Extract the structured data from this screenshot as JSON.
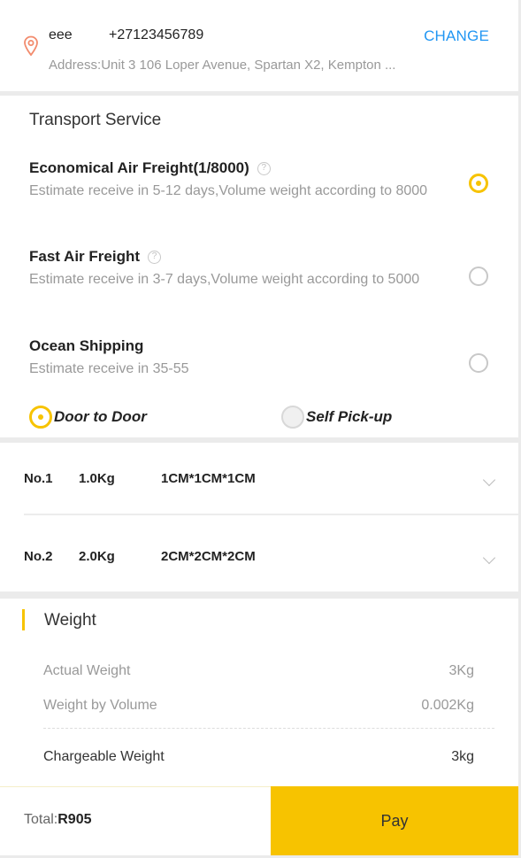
{
  "address": {
    "name": "eee",
    "phone": "+27123456789",
    "change_label": "CHANGE",
    "line": "Address:Unit 3 106 Loper Avenue, Spartan X2, Kempton ..."
  },
  "transport": {
    "title": "Transport Service",
    "options": [
      {
        "title": "Economical Air Freight(1/8000)",
        "has_help": true,
        "desc": "Estimate receive in 5-12 days,Volume weight according to 8000",
        "selected": true
      },
      {
        "title": "Fast Air Freight",
        "has_help": true,
        "desc": "Estimate receive in 3-7 days,Volume weight according to 5000",
        "selected": false
      },
      {
        "title": "Ocean Shipping",
        "has_help": false,
        "desc": "Estimate receive in 35-55",
        "selected": false
      }
    ],
    "delivery": [
      {
        "label": "Door to Door",
        "selected": true
      },
      {
        "label": "Self Pick-up",
        "selected": false
      }
    ]
  },
  "packages": [
    {
      "no": "No.1",
      "weight": "1.0Kg",
      "dims": "1CM*1CM*1CM"
    },
    {
      "no": "No.2",
      "weight": "2.0Kg",
      "dims": "2CM*2CM*2CM"
    }
  ],
  "weight": {
    "title": "Weight",
    "actual_label": "Actual Weight",
    "actual_value": "3Kg",
    "volume_label": "Weight by Volume",
    "volume_value": "0.002Kg",
    "chargeable_label": "Chargeable Weight",
    "chargeable_value": "3kg"
  },
  "footer": {
    "total_label": "Total:",
    "total_value": "R905",
    "pay_label": "Pay"
  },
  "colors": {
    "accent": "#f7c300",
    "link": "#2196f3",
    "pin": "#f28b6d"
  },
  "icons": [
    "location-pin-icon",
    "help-circle-icon",
    "chevron-down-icon",
    "radio-icon"
  ]
}
